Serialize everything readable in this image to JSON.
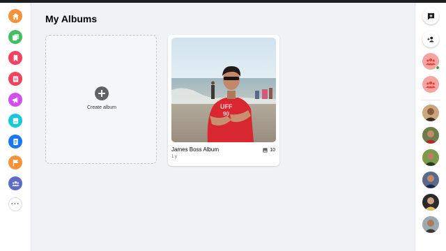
{
  "page": {
    "title": "My Albums"
  },
  "create_album": {
    "label": "Create album",
    "icon": "plus-circle-icon"
  },
  "albums": [
    {
      "name": "James Boss Album",
      "time": "1 y",
      "count": "10",
      "count_icon": "image-icon"
    }
  ],
  "left_nav": {
    "items": [
      {
        "icon": "home-icon",
        "color": "#f7923a"
      },
      {
        "icon": "pages-icon",
        "color": "#45bd62"
      },
      {
        "icon": "saved-icon",
        "color": "#f3425f"
      },
      {
        "icon": "notes-icon",
        "color": "#f3425f"
      },
      {
        "icon": "megaphone-icon",
        "color": "#d34df0"
      },
      {
        "icon": "blog-icon",
        "color": "#17c9d6"
      },
      {
        "icon": "document-icon",
        "color": "#1877f2"
      },
      {
        "icon": "flag-icon",
        "color": "#f7923a"
      },
      {
        "icon": "groups-icon",
        "color": "#5f6cc7"
      }
    ],
    "more_icon": "more-dots-icon"
  },
  "right_rail": {
    "actions": [
      {
        "icon": "new-message-icon"
      },
      {
        "icon": "add-friend-icon"
      }
    ],
    "group_chats": [
      {
        "icon": "group-chat-icon",
        "online": true
      },
      {
        "icon": "group-chat-icon",
        "online": false
      }
    ],
    "contacts_count_icons": [
      "contact-avatar-1",
      "contact-avatar-2",
      "contact-avatar-3",
      "contact-avatar-4",
      "contact-avatar-5",
      "contact-avatar-6"
    ]
  },
  "colors": {
    "accent_blue": "#1877f2",
    "online": "#31a24c",
    "group_red": "#e8433a"
  }
}
